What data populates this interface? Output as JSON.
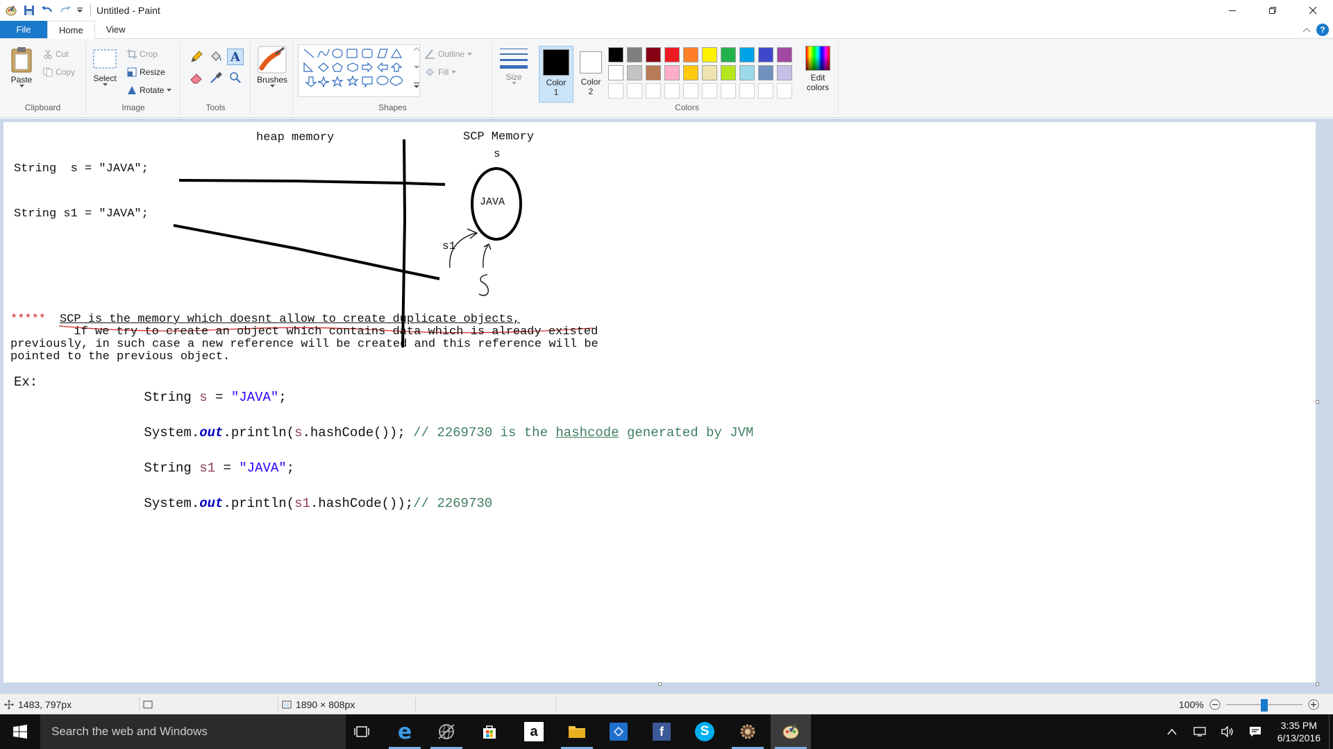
{
  "window": {
    "title": "Untitled - Paint",
    "controls": {
      "minimize": "minimize-icon",
      "maximize": "restore-icon",
      "close": "close-icon"
    }
  },
  "tabs": [
    {
      "label": "File"
    },
    {
      "label": "Home"
    },
    {
      "label": "View"
    }
  ],
  "ribbon": {
    "clipboard": {
      "group_label": "Clipboard",
      "paste": "Paste",
      "cut": "Cut",
      "copy": "Copy"
    },
    "image": {
      "group_label": "Image",
      "select": "Select",
      "crop": "Crop",
      "resize": "Resize",
      "rotate": "Rotate"
    },
    "tools": {
      "group_label": "Tools"
    },
    "brushes": {
      "label": "Brushes"
    },
    "shapes": {
      "group_label": "Shapes",
      "outline": "Outline",
      "fill": "Fill"
    },
    "size": {
      "label": "Size"
    },
    "color1": {
      "label_line1": "Color",
      "label_line2": "1",
      "value": "#000000"
    },
    "color2": {
      "label_line1": "Color",
      "label_line2": "2",
      "value": "#ffffff"
    },
    "colors": {
      "group_label": "Colors",
      "row1": [
        "#000000",
        "#7f7f7f",
        "#880015",
        "#ed1c24",
        "#ff7f27",
        "#fff200",
        "#22b14c",
        "#00a2e8",
        "#3f48cc",
        "#a349a4"
      ],
      "row2": [
        "#ffffff",
        "#c3c3c3",
        "#b97a57",
        "#ffaec9",
        "#ffc90e",
        "#efe4b0",
        "#b5e61d",
        "#99d9ea",
        "#7092be",
        "#c8bfe7"
      ],
      "edit_line1": "Edit",
      "edit_line2": "colors"
    }
  },
  "canvas_content": {
    "heap_label": "heap memory",
    "scp_label": "SCP Memory",
    "line1": "String  s = \"JAVA\";",
    "line2": "String s1 = \"JAVA\";",
    "circle_text": "JAVA",
    "ref_s": "s",
    "ref_s1": "s1",
    "note_stars": "*****",
    "note_line1": "SCP is the memory which doesnt allow to create duplicate objects,",
    "note_line2": "  if we try to create an object which contains data which is already existed",
    "note_line3": "previously, in such case a new reference will be created and this reference will be",
    "note_line4": "pointed to the previous object.",
    "ex_label": "Ex:",
    "code": {
      "l1_a": "String ",
      "l1_var": "s",
      "l1_b": " = ",
      "l1_str": "\"JAVA\"",
      "l1_c": ";",
      "l2_a": "System.",
      "l2_out": "out",
      "l2_b": ".println(",
      "l2_var": "s",
      "l2_c": ".hashCode()); ",
      "l2_comment1": "// 2269730 is the ",
      "l2_comment_link": "hashcode",
      "l2_comment2": " generated by JVM",
      "l3_a": "String ",
      "l3_var": "s1",
      "l3_b": " = ",
      "l3_str": "\"JAVA\"",
      "l3_c": ";",
      "l4_a": "System.",
      "l4_out": "out",
      "l4_b": ".println(",
      "l4_var": "s1",
      "l4_c": ".hashCode());",
      "l4_comment": "// 2269730"
    }
  },
  "statusbar": {
    "cursor_pos": "1483, 797px",
    "canvas_size": "1890 × 808px",
    "zoom": "100%"
  },
  "taskbar": {
    "search_placeholder": "Search the web and Windows",
    "time": "3:35 PM",
    "date": "6/13/2016"
  }
}
